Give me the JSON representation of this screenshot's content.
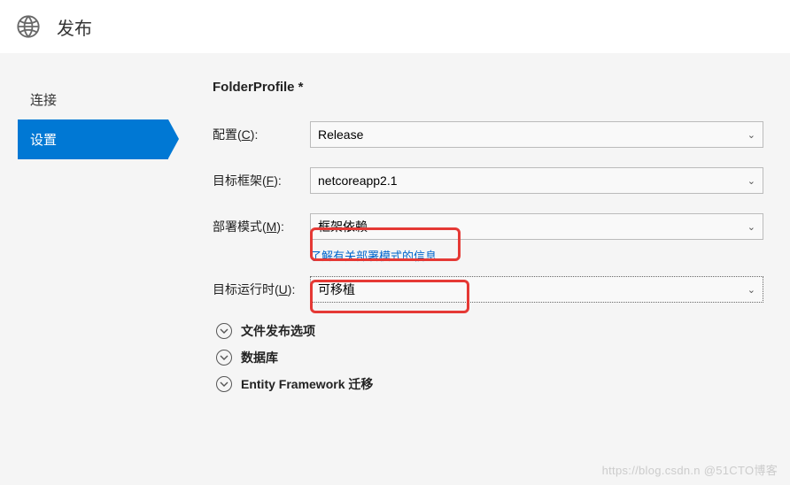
{
  "header": {
    "title": "发布"
  },
  "sidebar": {
    "items": [
      {
        "label": "连接"
      },
      {
        "label": "设置"
      }
    ],
    "active_index": 1
  },
  "main": {
    "profile_title": "FolderProfile *",
    "rows": [
      {
        "label_prefix": "配置(",
        "accel": "C",
        "label_suffix": "):",
        "value": "Release"
      },
      {
        "label_prefix": "目标框架(",
        "accel": "F",
        "label_suffix": "):",
        "value": "netcoreapp2.1"
      },
      {
        "label_prefix": "部署模式(",
        "accel": "M",
        "label_suffix": "):",
        "value": "框架依赖"
      },
      {
        "label_prefix": "目标运行时(",
        "accel": "U",
        "label_suffix": "):",
        "value": "可移植"
      }
    ],
    "deploy_mode_hint": "了解有关部署模式的信息",
    "expandables": [
      {
        "label": "文件发布选项"
      },
      {
        "label": "数据库"
      },
      {
        "label": "Entity Framework 迁移"
      }
    ]
  },
  "watermark": "https://blog.csdn.n @51CTO博客"
}
